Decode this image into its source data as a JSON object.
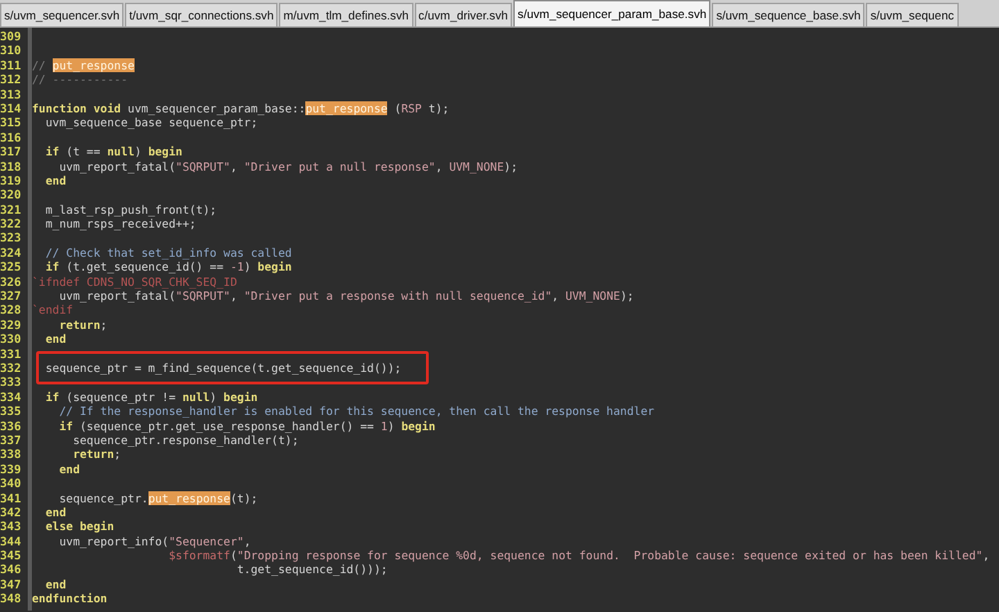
{
  "tabs": [
    {
      "label": "s/uvm_sequencer.svh",
      "selected": false
    },
    {
      "label": "t/uvm_sqr_connections.svh",
      "selected": false
    },
    {
      "label": "m/uvm_tlm_defines.svh",
      "selected": false
    },
    {
      "label": "c/uvm_driver.svh",
      "selected": false
    },
    {
      "label": "s/uvm_sequencer_param_base.svh",
      "selected": true
    },
    {
      "label": "s/uvm_sequence_base.svh",
      "selected": false
    },
    {
      "label": "s/uvm_sequenc",
      "selected": false
    }
  ],
  "lines": [
    {
      "number": "309"
    },
    {
      "number": "310"
    },
    {
      "number": "311",
      "tokens": [
        {
          "text": "// ",
          "kind": "dim"
        },
        {
          "text": "put_response",
          "kind": "match"
        }
      ]
    },
    {
      "number": "312",
      "tokens": [
        {
          "text": "// -----------",
          "kind": "dim"
        }
      ]
    },
    {
      "number": "313"
    },
    {
      "number": "314",
      "tokens": [
        {
          "text": "function void",
          "kind": "keyword"
        },
        {
          "text": " uvm_sequencer_param_base::",
          "kind": "plain"
        },
        {
          "text": "put_response",
          "kind": "match"
        },
        {
          "text": " (",
          "kind": "plain"
        },
        {
          "text": "RSP",
          "kind": "string"
        },
        {
          "text": " t);",
          "kind": "plain"
        }
      ]
    },
    {
      "number": "315",
      "tokens": [
        {
          "text": "  uvm_sequence_base sequence_ptr;",
          "kind": "plain"
        }
      ]
    },
    {
      "number": "316"
    },
    {
      "number": "317",
      "tokens": [
        {
          "text": "  if",
          "kind": "keyword"
        },
        {
          "text": " (t == ",
          "kind": "plain"
        },
        {
          "text": "null",
          "kind": "keyword"
        },
        {
          "text": ") ",
          "kind": "plain"
        },
        {
          "text": "begin",
          "kind": "keyword"
        }
      ]
    },
    {
      "number": "318",
      "tokens": [
        {
          "text": "    uvm_report_fatal(",
          "kind": "plain"
        },
        {
          "text": "\"SQRPUT\"",
          "kind": "string"
        },
        {
          "text": ", ",
          "kind": "plain"
        },
        {
          "text": "\"Driver put a null response\"",
          "kind": "string"
        },
        {
          "text": ", ",
          "kind": "plain"
        },
        {
          "text": "UVM_NONE",
          "kind": "string"
        },
        {
          "text": ");",
          "kind": "plain"
        }
      ]
    },
    {
      "number": "319",
      "tokens": [
        {
          "text": "  end",
          "kind": "keyword"
        }
      ]
    },
    {
      "number": "320"
    },
    {
      "number": "321",
      "tokens": [
        {
          "text": "  m_last_rsp_push_front(t);",
          "kind": "plain"
        }
      ]
    },
    {
      "number": "322",
      "tokens": [
        {
          "text": "  m_num_rsps_received++;",
          "kind": "plain"
        }
      ]
    },
    {
      "number": "323"
    },
    {
      "number": "324",
      "tokens": [
        {
          "text": "  // Check that set_id_info was called",
          "kind": "comment"
        }
      ]
    },
    {
      "number": "325",
      "tokens": [
        {
          "text": "  if",
          "kind": "keyword"
        },
        {
          "text": " (t.get_sequence_id() == ",
          "kind": "plain"
        },
        {
          "text": "-1",
          "kind": "string"
        },
        {
          "text": ") ",
          "kind": "plain"
        },
        {
          "text": "begin",
          "kind": "keyword"
        }
      ]
    },
    {
      "number": "326",
      "tokens": [
        {
          "text": "`ifndef CDNS_NO_SQR_CHK_SEQ_ID",
          "kind": "preproc"
        }
      ]
    },
    {
      "number": "327",
      "tokens": [
        {
          "text": "    uvm_report_fatal(",
          "kind": "plain"
        },
        {
          "text": "\"SQRPUT\"",
          "kind": "string"
        },
        {
          "text": ", ",
          "kind": "plain"
        },
        {
          "text": "\"Driver put a response with null sequence_id\"",
          "kind": "string"
        },
        {
          "text": ", ",
          "kind": "plain"
        },
        {
          "text": "UVM_NONE",
          "kind": "string"
        },
        {
          "text": ");",
          "kind": "plain"
        }
      ]
    },
    {
      "number": "328",
      "tokens": [
        {
          "text": "`endif",
          "kind": "preproc"
        }
      ]
    },
    {
      "number": "329",
      "tokens": [
        {
          "text": "    return",
          "kind": "keyword"
        },
        {
          "text": ";",
          "kind": "plain"
        }
      ]
    },
    {
      "number": "330",
      "tokens": [
        {
          "text": "  end",
          "kind": "keyword"
        }
      ]
    },
    {
      "number": "331"
    },
    {
      "number": "332",
      "boxed": true,
      "tokens": [
        {
          "text": "  sequence_ptr = m_find_sequence(t.get_sequence_id());",
          "kind": "plain"
        }
      ]
    },
    {
      "number": "333"
    },
    {
      "number": "334",
      "tokens": [
        {
          "text": "  if",
          "kind": "keyword"
        },
        {
          "text": " (sequence_ptr != ",
          "kind": "plain"
        },
        {
          "text": "null",
          "kind": "keyword"
        },
        {
          "text": ") ",
          "kind": "plain"
        },
        {
          "text": "begin",
          "kind": "keyword"
        }
      ]
    },
    {
      "number": "335",
      "tokens": [
        {
          "text": "    // If the response_handler is enabled for this sequence, then call the response handler",
          "kind": "comment"
        }
      ]
    },
    {
      "number": "336",
      "tokens": [
        {
          "text": "    if",
          "kind": "keyword"
        },
        {
          "text": " (sequence_ptr.get_use_response_handler() == ",
          "kind": "plain"
        },
        {
          "text": "1",
          "kind": "string"
        },
        {
          "text": ") ",
          "kind": "plain"
        },
        {
          "text": "begin",
          "kind": "keyword"
        }
      ]
    },
    {
      "number": "337",
      "tokens": [
        {
          "text": "      sequence_ptr.response_handler(t);",
          "kind": "plain"
        }
      ]
    },
    {
      "number": "338",
      "tokens": [
        {
          "text": "      return",
          "kind": "keyword"
        },
        {
          "text": ";",
          "kind": "plain"
        }
      ]
    },
    {
      "number": "339",
      "tokens": [
        {
          "text": "    end",
          "kind": "keyword"
        }
      ]
    },
    {
      "number": "340"
    },
    {
      "number": "341",
      "tokens": [
        {
          "text": "    sequence_ptr.",
          "kind": "plain"
        },
        {
          "text": "put_response",
          "kind": "match"
        },
        {
          "text": "(t);",
          "kind": "plain"
        }
      ]
    },
    {
      "number": "342",
      "tokens": [
        {
          "text": "  end",
          "kind": "keyword"
        }
      ]
    },
    {
      "number": "343",
      "tokens": [
        {
          "text": "  else begin",
          "kind": "keyword"
        }
      ]
    },
    {
      "number": "344",
      "tokens": [
        {
          "text": "    uvm_report_info(",
          "kind": "plain"
        },
        {
          "text": "\"Sequencer\"",
          "kind": "string"
        },
        {
          "text": ",",
          "kind": "plain"
        }
      ]
    },
    {
      "number": "345",
      "tokens": [
        {
          "text": "                    $sformatf",
          "kind": "sysfunc"
        },
        {
          "text": "(",
          "kind": "plain"
        },
        {
          "text": "\"Dropping response for sequence %0d, sequence not found.  Probable cause: sequence exited or has been killed\"",
          "kind": "string"
        },
        {
          "text": ",",
          "kind": "plain"
        }
      ]
    },
    {
      "number": "346",
      "tokens": [
        {
          "text": "                              t.get_sequence_id()));",
          "kind": "plain"
        }
      ]
    },
    {
      "number": "347",
      "tokens": [
        {
          "text": "  end",
          "kind": "keyword"
        }
      ]
    },
    {
      "number": "348",
      "tokens": [
        {
          "text": "endfunction",
          "kind": "keyword"
        }
      ]
    }
  ]
}
